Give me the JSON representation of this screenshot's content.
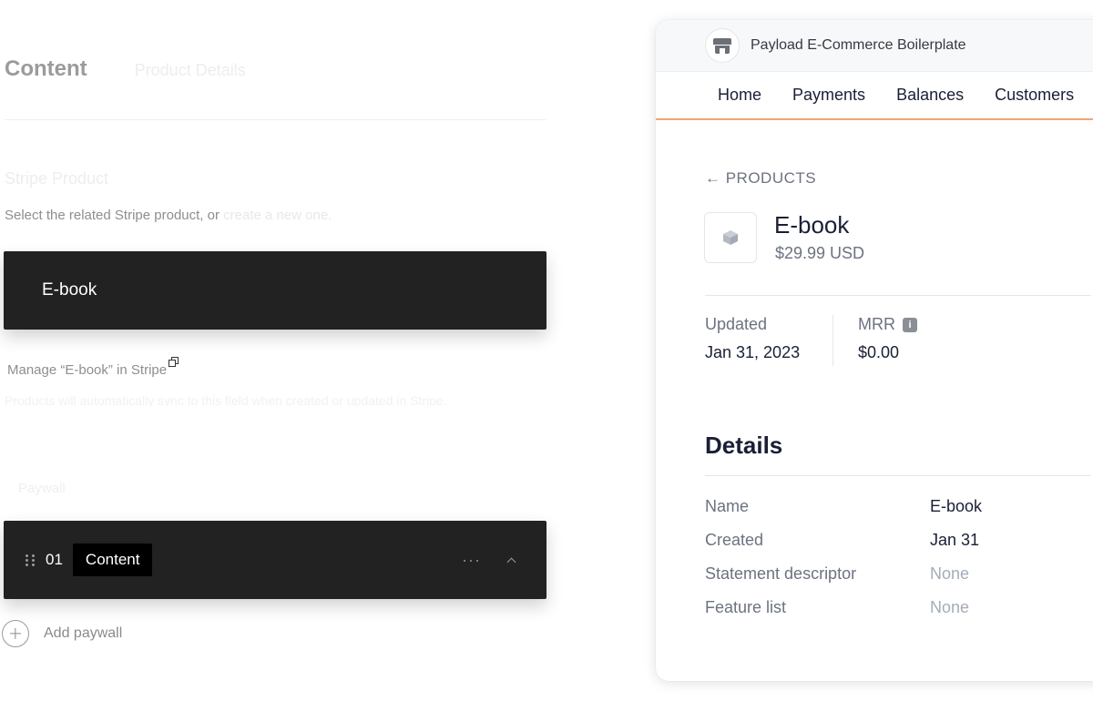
{
  "payload": {
    "tabs": [
      "Content",
      "Product Details"
    ],
    "field": {
      "label": "Stripe Product",
      "description": "Select the related Stripe product, or",
      "description_link": "create a new one."
    },
    "selected_product": "E-book",
    "manage_link": "Manage “E-book” in Stripe",
    "faint_note": "Products will automatically sync to this field when created or updated in Stripe.",
    "paywall_label": "Paywall",
    "row": {
      "number": "01",
      "label": "Content",
      "more": "···"
    },
    "add_label": "Add paywall"
  },
  "stripe": {
    "account_name": "Payload E-Commerce Boilerplate",
    "nav": [
      "Home",
      "Payments",
      "Balances",
      "Customers"
    ],
    "breadcrumb": "← PRODUCTS",
    "product": {
      "name": "E-book",
      "price": "$29.99 USD"
    },
    "stats": [
      {
        "label": "Updated",
        "value": "Jan 31, 2023"
      },
      {
        "label": "MRR",
        "value": "$0.00"
      }
    ],
    "details_title": "Details",
    "details": [
      {
        "key": "Name",
        "value": "E-book",
        "muted": false
      },
      {
        "key": "Created",
        "value": "Jan 31",
        "muted": false
      },
      {
        "key": "Statement descriptor",
        "value": "None",
        "muted": true
      },
      {
        "key": "Feature list",
        "value": "None",
        "muted": true
      }
    ]
  },
  "icons": {
    "external_link": "external-link-icon",
    "drag": "drag-handle-icon",
    "collapse": "chevron-up-icon",
    "add": "plus-circle-icon",
    "store": "store-icon",
    "product_box": "box-icon",
    "info": "info-icon"
  },
  "colors": {
    "dark_panel": "#222222",
    "nav_underline": "#f0a673"
  }
}
